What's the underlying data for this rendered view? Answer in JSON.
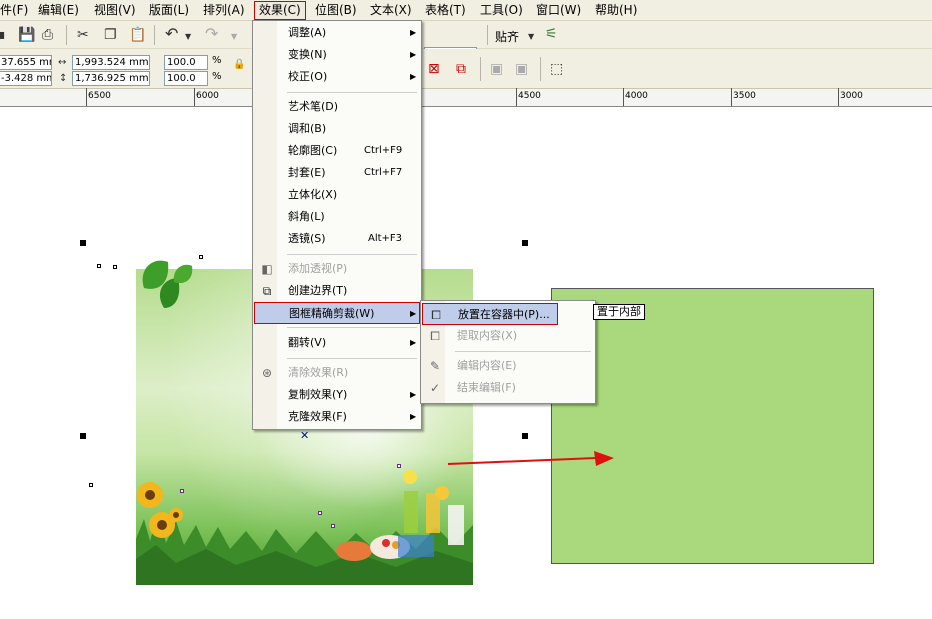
{
  "menubar": {
    "items": [
      {
        "label": "件(F)"
      },
      {
        "label": "编辑(E)"
      },
      {
        "label": "视图(V)"
      },
      {
        "label": "版面(L)"
      },
      {
        "label": "排列(A)"
      },
      {
        "label": "效果(C)"
      },
      {
        "label": "位图(B)"
      },
      {
        "label": "文本(X)"
      },
      {
        "label": "表格(T)"
      },
      {
        "label": "工具(O)"
      },
      {
        "label": "窗口(W)"
      },
      {
        "label": "帮助(H)"
      }
    ]
  },
  "toolbar": {
    "snap_label": "贴齐",
    "x_value": "37.655 mm",
    "y_value": "-3.428 mm",
    "width_value": "1,993.524 mm",
    "height_value": "1,736.925 mm",
    "scale_x": "100.0",
    "scale_y": "100.0",
    "percent": "%"
  },
  "ruler": {
    "labels": [
      "6500",
      "6000",
      "4500",
      "4000",
      "3500",
      "3000"
    ]
  },
  "effects_menu": {
    "items": [
      {
        "label": "调整(A)",
        "arrow": "▶"
      },
      {
        "label": "变换(N)",
        "arrow": "▶"
      },
      {
        "label": "校正(O)",
        "arrow": "▶"
      },
      {
        "label": "艺术笔(D)"
      },
      {
        "label": "调和(B)"
      },
      {
        "label": "轮廓图(C)",
        "shortcut": "Ctrl+F9"
      },
      {
        "label": "封套(E)",
        "shortcut": "Ctrl+F7"
      },
      {
        "label": "立体化(X)"
      },
      {
        "label": "斜角(L)"
      },
      {
        "label": "透镜(S)",
        "shortcut": "Alt+F3"
      },
      {
        "label": "添加透视(P)"
      },
      {
        "label": "创建边界(T)"
      },
      {
        "label": "图框精确剪裁(W)",
        "arrow": "▶"
      },
      {
        "label": "翻转(V)",
        "arrow": "▶"
      },
      {
        "label": "清除效果(R)"
      },
      {
        "label": "复制效果(Y)",
        "arrow": "▶"
      },
      {
        "label": "克隆效果(F)",
        "arrow": "▶"
      }
    ]
  },
  "powerclip_submenu": {
    "items": [
      {
        "label": "放置在容器中(P)..."
      },
      {
        "label": "提取内容(X)"
      },
      {
        "label": "编辑内容(E)"
      },
      {
        "label": "结束编辑(F)"
      }
    ]
  },
  "tooltip": {
    "text": "置于内部"
  },
  "colors": {
    "container_fill": "#a9d97c",
    "highlight_border": "#d00000",
    "arrow": "#e01010"
  }
}
